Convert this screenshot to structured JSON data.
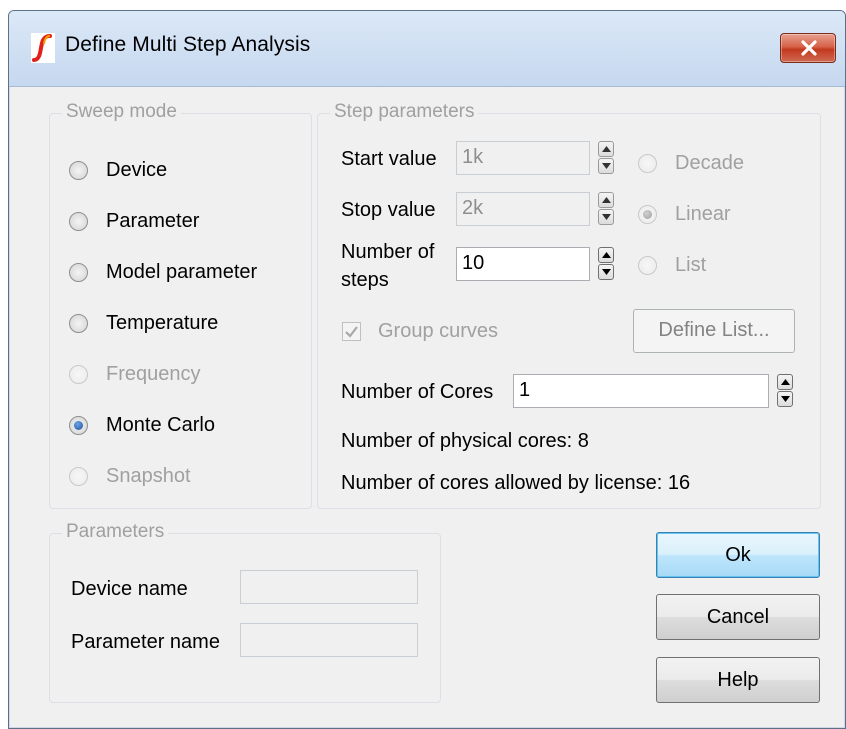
{
  "window": {
    "title": "Define Multi Step Analysis",
    "icon": "simetrix-logo-icon",
    "close_icon": "close-icon",
    "close_color": "#c43a20"
  },
  "sweep_mode": {
    "label": "Sweep mode",
    "options": [
      {
        "label": "Device",
        "selected": false,
        "enabled": true
      },
      {
        "label": "Parameter",
        "selected": false,
        "enabled": true
      },
      {
        "label": "Model parameter",
        "selected": false,
        "enabled": true
      },
      {
        "label": "Temperature",
        "selected": false,
        "enabled": true
      },
      {
        "label": "Frequency",
        "selected": false,
        "enabled": false
      },
      {
        "label": "Monte Carlo",
        "selected": true,
        "enabled": true
      },
      {
        "label": "Snapshot",
        "selected": false,
        "enabled": false
      }
    ]
  },
  "step_parameters": {
    "label": "Step parameters",
    "start_value_label": "Start value",
    "start_value": "1k",
    "stop_value_label": "Stop value",
    "stop_value": "2k",
    "num_steps_label_line1": "Number of",
    "num_steps_label_line2": "steps",
    "num_steps": "10",
    "scale_options": [
      {
        "label": "Decade",
        "selected": false,
        "enabled": false
      },
      {
        "label": "Linear",
        "selected": true,
        "enabled": false
      },
      {
        "label": "List",
        "selected": false,
        "enabled": false
      }
    ],
    "group_curves_label": "Group curves",
    "group_curves_checked": true,
    "define_list_label": "Define List...",
    "num_cores_label": "Number of Cores",
    "num_cores": "1",
    "physical_cores_text": "Number of physical cores: 8",
    "licensed_cores_text": "Number of cores allowed by license: 16"
  },
  "parameters": {
    "label": "Parameters",
    "device_name_label": "Device name",
    "device_name": "",
    "parameter_name_label": "Parameter name",
    "parameter_name": ""
  },
  "buttons": {
    "ok": "Ok",
    "cancel": "Cancel",
    "help": "Help"
  }
}
